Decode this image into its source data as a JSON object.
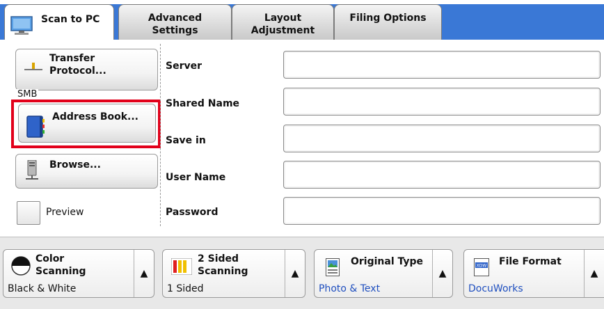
{
  "tabs": [
    {
      "label": "Scan to PC",
      "active": true
    },
    {
      "label": "Advanced\nSettings"
    },
    {
      "label": "Layout\nAdjustment"
    },
    {
      "label": "Filing Options"
    }
  ],
  "left": {
    "transfer": {
      "label": "Transfer\nProtocol...",
      "value": "SMB"
    },
    "address_book": {
      "label": "Address Book..."
    },
    "browse": {
      "label": "Browse..."
    },
    "preview": {
      "label": "Preview",
      "checked": false
    }
  },
  "fields": [
    {
      "label": "Server",
      "value": ""
    },
    {
      "label": "Shared Name",
      "value": ""
    },
    {
      "label": "Save in",
      "value": ""
    },
    {
      "label": "User Name",
      "value": ""
    },
    {
      "label": "Password",
      "value": ""
    }
  ],
  "features": [
    {
      "title": "Color\nScanning",
      "value": "Black & White",
      "value_color": "black"
    },
    {
      "title": "2 Sided\nScanning",
      "value": "1 Sided",
      "value_color": "black"
    },
    {
      "title": "Original Type",
      "value": "Photo & Text",
      "value_color": "blue"
    },
    {
      "title": "File Format",
      "value": "DocuWorks",
      "value_color": "blue"
    }
  ],
  "icon_text": {
    "file_format": "XDW"
  },
  "colors": {
    "tab_bar": "#3a78d6",
    "highlight": "#e2001a",
    "value_blue": "#1f4fbf"
  }
}
